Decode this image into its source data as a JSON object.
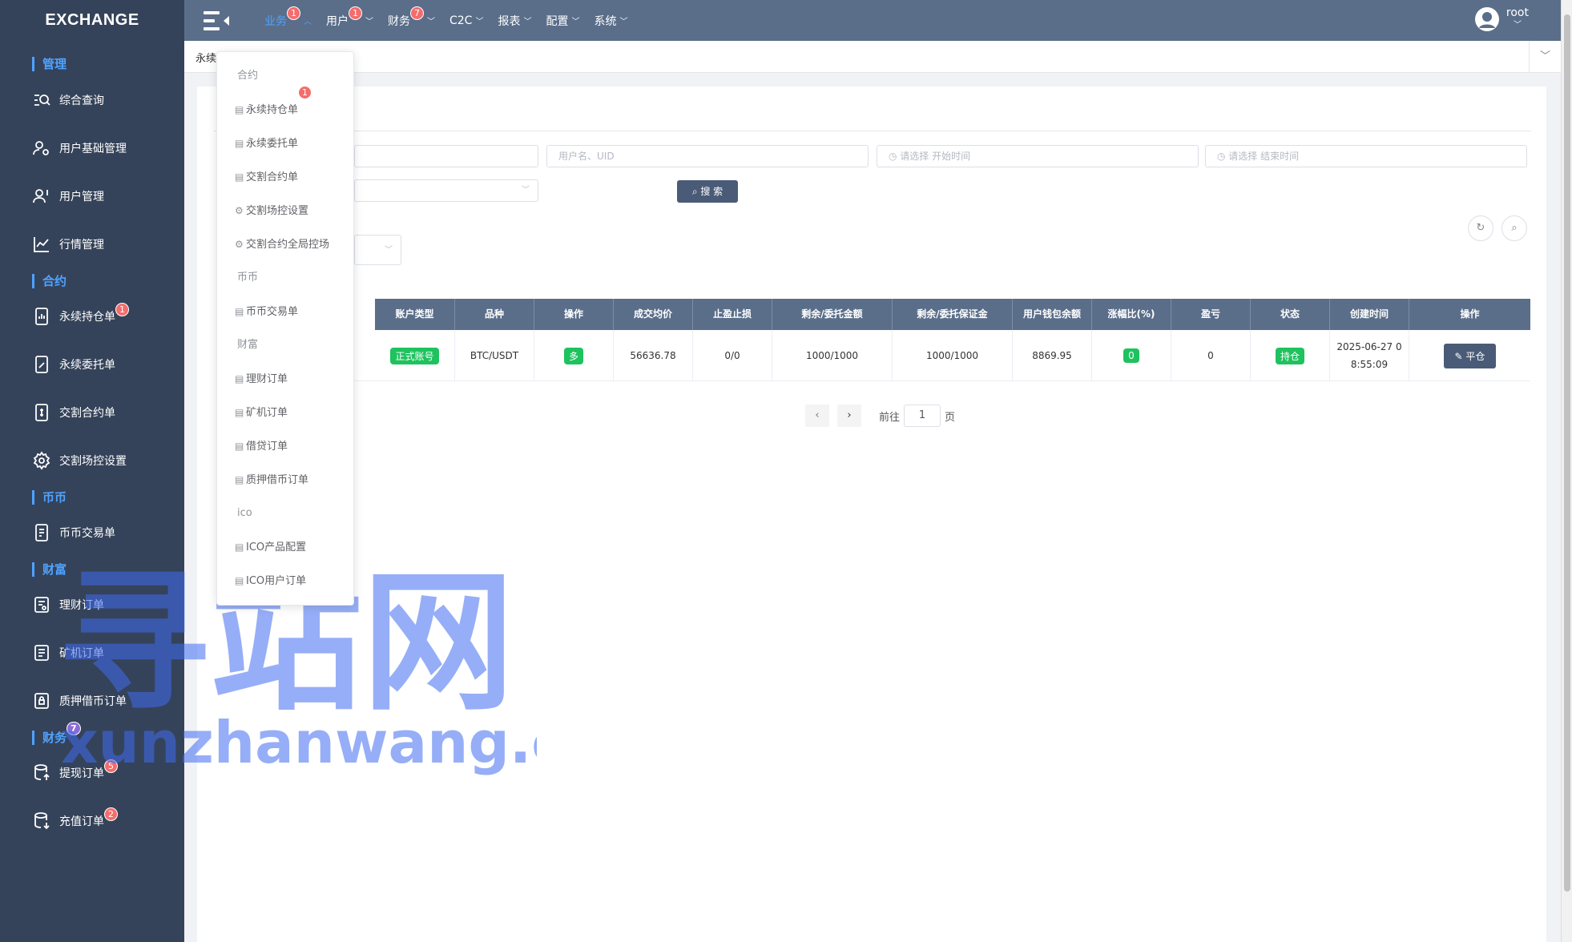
{
  "sidebar": {
    "brand": "EXCHANGE",
    "groups": {
      "manage": "管理",
      "contract": "合约",
      "coin": "币币",
      "wealth": "财富",
      "finance": "财务"
    },
    "finance_badge": "7",
    "items": {
      "query": "综合查询",
      "user_basic": "用户基础管理",
      "user_mgmt": "用户管理",
      "market": "行情管理",
      "perp_positions": "永续持仓单",
      "perp_positions_badge": "1",
      "perp_orders": "永续委托单",
      "delivery_orders": "交割合约单",
      "delivery_control": "交割场控设置",
      "spot_orders": "币币交易单",
      "wealth_orders": "理财订单",
      "miner_orders": "矿机订单",
      "pledge_orders": "质押借币订单",
      "withdraw_orders": "提现订单",
      "withdraw_badge": "5",
      "deposit_orders": "充值订单",
      "deposit_badge": "2"
    }
  },
  "topbar": {
    "menus": [
      {
        "label": "业务",
        "badge": "1"
      },
      {
        "label": "用户",
        "badge": "1"
      },
      {
        "label": "财务",
        "badge": "7"
      },
      {
        "label": "C2C"
      },
      {
        "label": "报表"
      },
      {
        "label": "配置"
      },
      {
        "label": "系统"
      }
    ],
    "user": "root"
  },
  "tabs": {
    "current": "永续"
  },
  "search": {
    "user_placeholder": "用户名、UID",
    "start_placeholder": "请选择 开始时间",
    "end_placeholder": "请选择 结束时间",
    "search_button": "搜 索"
  },
  "table": {
    "headers": [
      "账户类型",
      "品种",
      "操作",
      "成交均价",
      "止盈止损",
      "剩余/委托金额",
      "剩余/委托保证金",
      "用户钱包余额",
      "涨幅比(%)",
      "盈亏",
      "状态",
      "创建时间",
      "操作"
    ],
    "row": {
      "account_type": "正式账号",
      "symbol": "BTC/USDT",
      "side": "多",
      "avg_price": "56636.78",
      "tp_sl": "0/0",
      "remaining_amount": "1000/1000",
      "remaining_margin": "1000/1000",
      "wallet_balance": "8869.95",
      "change_pct": "0",
      "pnl": "0",
      "status": "持仓",
      "created_line1": "2025-06-27 0",
      "created_line2": "8:55:09",
      "action": "平仓"
    }
  },
  "pagination": {
    "goto_label": "前往",
    "page": "1",
    "page_suffix": "页"
  },
  "dropdown": {
    "sections": {
      "contract": "合约",
      "coin": "币币",
      "wealth": "财富",
      "ico": "ico"
    },
    "items": {
      "perp_positions": "永续持仓单",
      "perp_positions_badge": "1",
      "perp_orders": "永续委托单",
      "delivery_orders": "交割合约单",
      "delivery_control": "交割场控设置",
      "delivery_global": "交割合约全局控场",
      "spot_orders": "币币交易单",
      "wealth_orders": "理财订单",
      "miner_orders": "矿机订单",
      "loan_orders": "借贷订单",
      "pledge_orders": "质押借币订单",
      "ico_config": "ICO产品配置",
      "ico_orders": "ICO用户订单"
    }
  },
  "watermark": {
    "cn": "寻站网",
    "en": "xunzhanwang.com"
  }
}
